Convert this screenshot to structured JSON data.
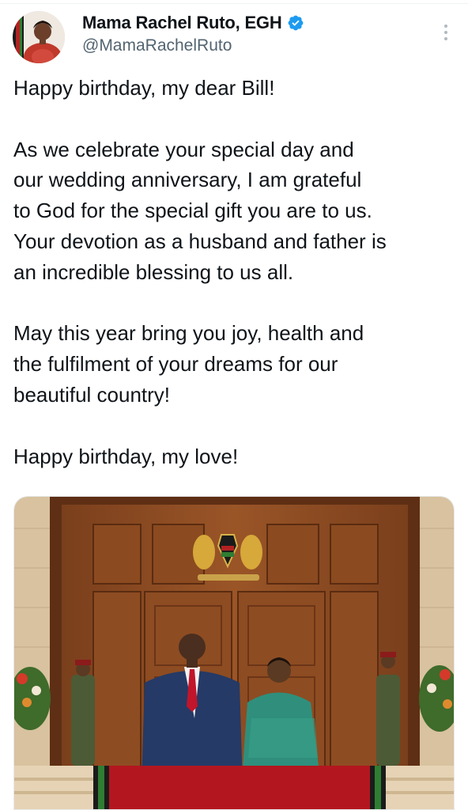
{
  "header": {
    "display_name": "Mama Rachel Ruto, EGH",
    "handle": "@MamaRachelRuto",
    "verified_icon": "verified-badge-icon",
    "more_icon": "more-options-icon",
    "verified_color": "#1d9bf0"
  },
  "tweet": {
    "line1": "Happy birthday, my dear Bill!",
    "p2_line1": "As we celebrate your special day and",
    "p2_line2": "our wedding anniversary, I am grateful",
    "p2_line3": "to God for the special gift you are to us.",
    "p2_line4": "Your devotion as a husband and father is",
    "p2_line5": "an incredible blessing to us all.",
    "p3_line1": "May this year bring you joy, health and",
    "p3_line2": "the fulfilment of your dreams for our",
    "p3_line3": "beautiful country!",
    "p4_line1": "Happy birthday, my love!"
  },
  "media": {
    "image_icon": "photo-couple-at-state-house-doors"
  }
}
